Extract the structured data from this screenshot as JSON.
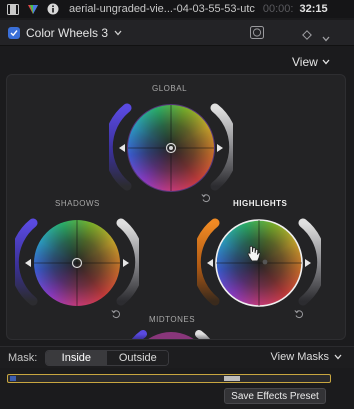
{
  "titlebar": {
    "clip_name": "aerial-ungraded-vie...-04-03-55-53-utc",
    "timecode_dim": "00:00:",
    "timecode": "32:15"
  },
  "effect": {
    "name": "Color Wheels 3",
    "enabled": true
  },
  "view_menu": {
    "label": "View"
  },
  "wheels": {
    "global": {
      "label": "GLOBAL"
    },
    "shadows": {
      "label": "SHADOWS"
    },
    "highlights": {
      "label": "HIGHLIGHTS"
    },
    "midtones": {
      "label": "MIDTONES"
    }
  },
  "mask": {
    "label": "Mask:",
    "inside": "Inside",
    "outside": "Outside",
    "selected": "Inside",
    "view_masks": "View Masks"
  },
  "save_preset": {
    "label": "Save Effects Preset"
  },
  "colors": {
    "accent_blue": "#3a6fd8",
    "strip_outline": "#c8a640",
    "highlights_left_slider": "#e0771a",
    "sat_slider_blue": "#4a3fd0"
  }
}
